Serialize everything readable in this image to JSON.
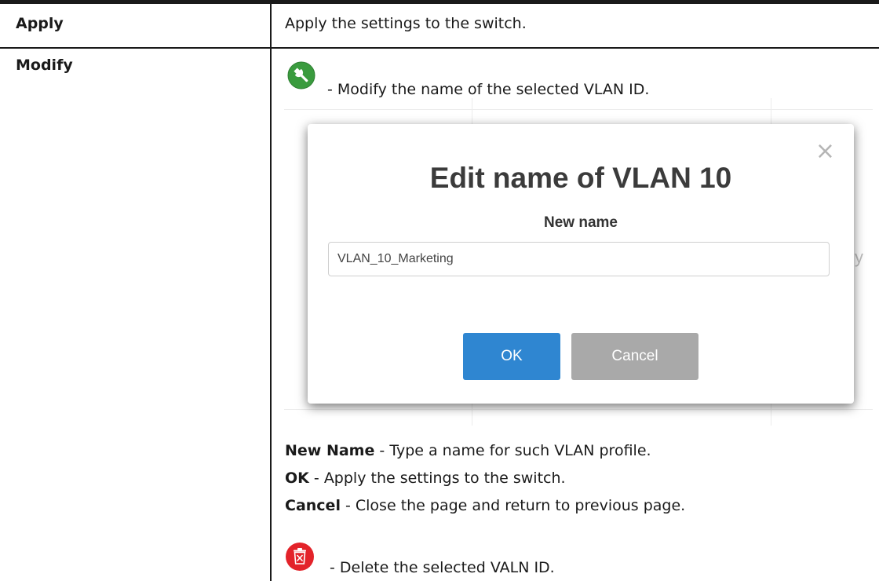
{
  "rows": [
    {
      "term": "Apply",
      "description": "Apply the settings to the switch."
    },
    {
      "term": "Modify",
      "icon_intro": {
        "icon": "wrench-icon",
        "color": "#3a9b3e",
        "text": "- Modify the name of the selected VLAN ID."
      },
      "dialog": {
        "title": "Edit name of VLAN 10",
        "field_label": "New name",
        "field_value": "VLAN_10_Marketing",
        "ok_label": "OK",
        "cancel_label": "Cancel",
        "close_icon": "close-icon",
        "background_fragment": "y"
      },
      "notes": [
        {
          "term": "New Name",
          "sep": " - ",
          "text": "Type a name for such VLAN profile."
        },
        {
          "term": "OK",
          "sep": " - ",
          "text": "Apply the settings to the switch."
        },
        {
          "term": "Cancel",
          "sep": " - ",
          "text": "Close the page and return to previous page."
        }
      ],
      "delete_line": {
        "icon": "trash-icon",
        "color": "#e3232a",
        "text": "- Delete the selected VALN ID."
      }
    }
  ],
  "colors": {
    "ok_button": "#2f86d1",
    "cancel_button": "#a9a9a9",
    "rule": "#1a1a1a"
  }
}
